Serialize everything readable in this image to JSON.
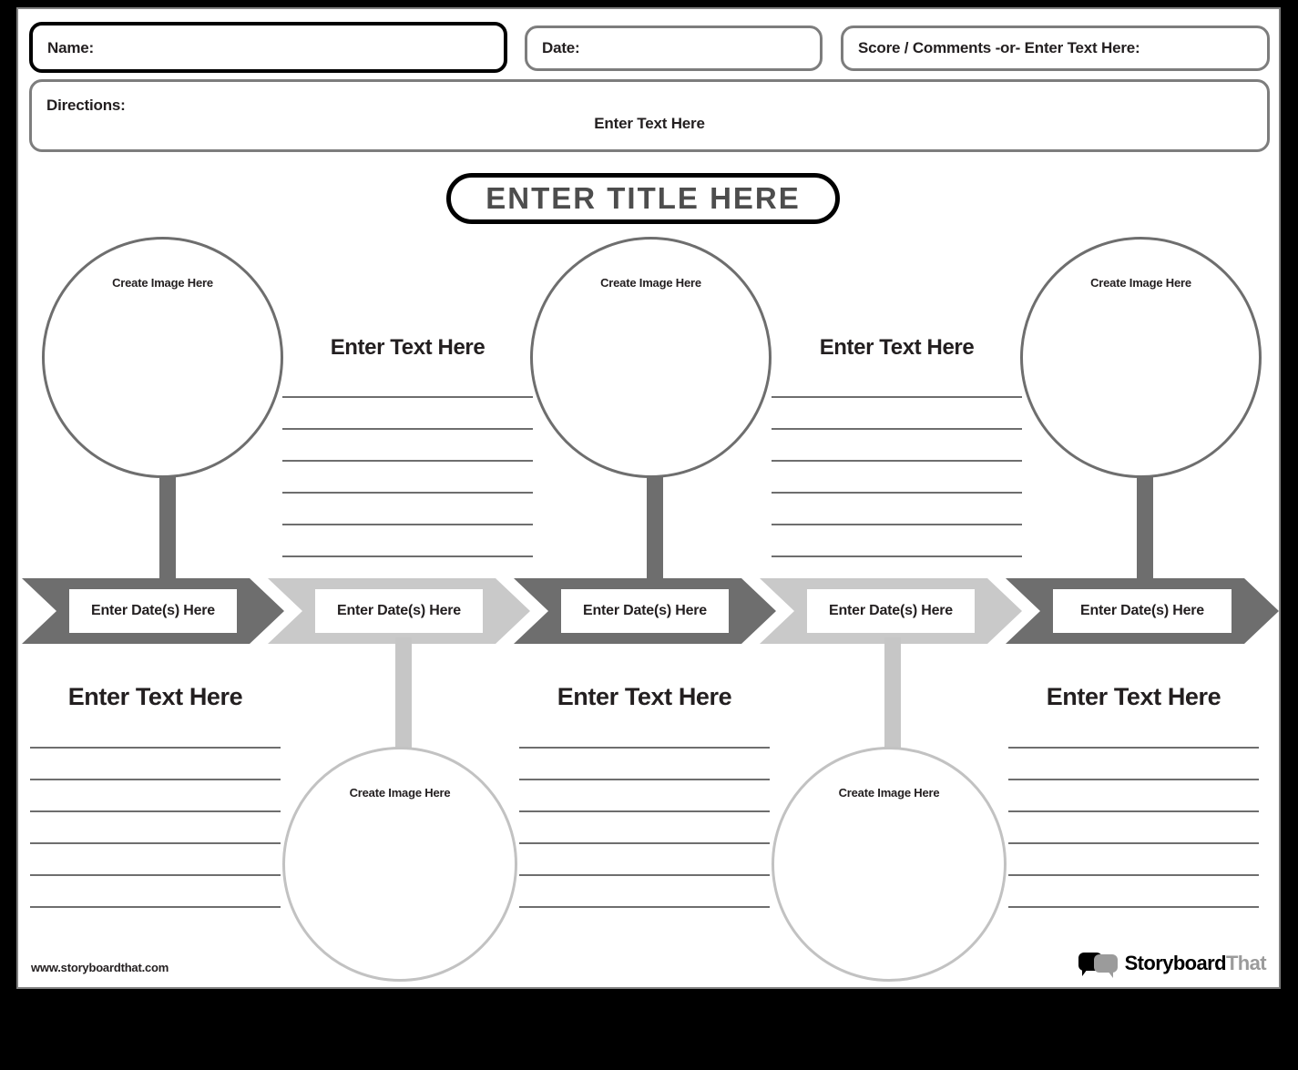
{
  "header": {
    "name_label": "Name:",
    "date_label": "Date:",
    "score_label": "Score / Comments -or- Enter Text Here:",
    "directions_label": "Directions:",
    "directions_placeholder": "Enter Text Here"
  },
  "title": {
    "text": "ENTER TITLE HERE"
  },
  "placeholders": {
    "image": "Create Image Here",
    "text": "Enter Text Here",
    "date": "Enter Date(s) Here"
  },
  "top_circles": [
    {
      "caption": "Create Image Here",
      "tone": "dark"
    },
    {
      "caption": "Create Image Here",
      "tone": "dark"
    },
    {
      "caption": "Create Image Here",
      "tone": "dark"
    }
  ],
  "top_text_blocks": [
    {
      "heading": "Enter Text Here",
      "lines": 6
    },
    {
      "heading": "Enter Text Here",
      "lines": 6
    }
  ],
  "timeline": {
    "steps": [
      {
        "label": "Enter Date(s) Here",
        "tone": "dark"
      },
      {
        "label": "Enter Date(s) Here",
        "tone": "light"
      },
      {
        "label": "Enter Date(s) Here",
        "tone": "dark"
      },
      {
        "label": "Enter Date(s) Here",
        "tone": "light"
      },
      {
        "label": "Enter Date(s) Here",
        "tone": "dark"
      }
    ]
  },
  "bottom_text_blocks": [
    {
      "heading": "Enter Text Here",
      "lines": 6
    },
    {
      "heading": "Enter Text Here",
      "lines": 6
    },
    {
      "heading": "Enter Text Here",
      "lines": 6
    }
  ],
  "bottom_circles": [
    {
      "caption": "Create Image Here",
      "tone": "light"
    },
    {
      "caption": "Create Image Here",
      "tone": "light"
    }
  ],
  "footer": {
    "url": "www.storyboardthat.com",
    "logo_primary": "Storyboard",
    "logo_secondary": "That"
  },
  "colors": {
    "dark_gray": "#6e6e6e",
    "light_gray": "#c9c9c9",
    "ink": "#231f20",
    "title_gray": "#4d4d4d"
  }
}
